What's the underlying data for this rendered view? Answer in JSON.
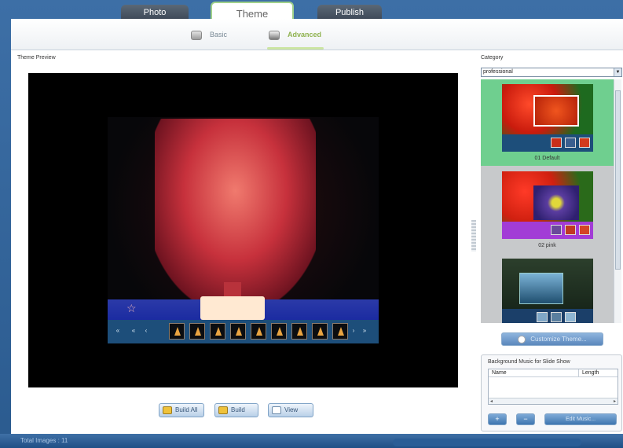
{
  "top_tabs": {
    "photo": "Photo",
    "theme": "Theme",
    "publish": "Publish"
  },
  "sub_tabs": {
    "basic": "Basic",
    "advanced": "Advanced"
  },
  "preview": {
    "label": "Theme Preview",
    "filmstrip": {
      "prev": "« ‹",
      "next": "›  »",
      "thumb_count": 9
    },
    "buttons": {
      "build_all": "Build All",
      "build": "Build",
      "view": "View"
    }
  },
  "category": {
    "label": "Category",
    "selected": "professional",
    "themes": [
      {
        "name": "01 Default",
        "selected": true
      },
      {
        "name": "02 pink",
        "selected": false
      },
      {
        "name": "",
        "selected": false
      }
    ],
    "customize_button": "Customize Theme..."
  },
  "music": {
    "title": "Background Music for Slide Show",
    "columns": {
      "name": "Name",
      "length": "Length"
    },
    "add": "+",
    "remove": "−",
    "edit": "Edit Music..."
  },
  "status": {
    "text": "Total Images : 11"
  },
  "colors": {
    "accent_green": "#6fcf8f",
    "tab_dark": "#4a5563",
    "frame_blue": "#2d5a8c",
    "filmstrip_blue": "#1d4e7a"
  }
}
